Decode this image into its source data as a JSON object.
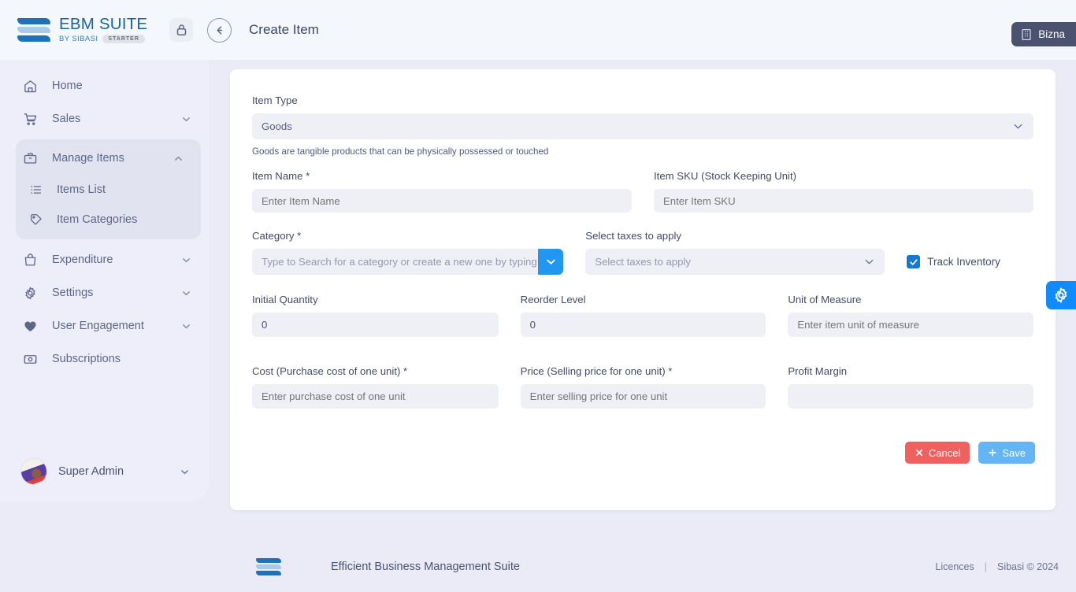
{
  "header": {
    "logo": {
      "title": "EBM SUITE",
      "subtitle": "BY SIBASI",
      "plan_badge": "STARTER"
    },
    "lock_icon": "lock-icon",
    "back_icon": "arrow-left-icon",
    "page_title": "Create Item",
    "org_badge": {
      "label": "Bizna",
      "icon": "building-icon"
    }
  },
  "sidebar": {
    "items": [
      {
        "label": "Home",
        "icon": "home-icon",
        "expandable": false
      },
      {
        "label": "Sales",
        "icon": "cart-icon",
        "expandable": true,
        "chevron": "chevron-down"
      },
      {
        "label": "Manage Items",
        "icon": "briefcase-icon",
        "expandable": true,
        "chevron": "chevron-up",
        "active": true
      },
      {
        "label": "Expenditure",
        "icon": "bag-icon",
        "expandable": true,
        "chevron": "chevron-down"
      },
      {
        "label": "Settings",
        "icon": "gear-icon",
        "expandable": true,
        "chevron": "chevron-down"
      },
      {
        "label": "User Engagement",
        "icon": "heart-icon",
        "expandable": true,
        "chevron": "chevron-down"
      },
      {
        "label": "Subscriptions",
        "icon": "subscription-icon",
        "expandable": false
      }
    ],
    "subitems": [
      {
        "label": "Items List",
        "icon": "list-icon"
      },
      {
        "label": "Item Categories",
        "icon": "tag-icon"
      }
    ],
    "user": {
      "name": "Super Admin",
      "chevron": "chevron-down"
    }
  },
  "form": {
    "item_type": {
      "label": "Item Type",
      "value": "Goods",
      "hint": "Goods are tangible products that can be physically possessed or touched"
    },
    "item_name": {
      "label": "Item Name *",
      "value": "",
      "placeholder": "Enter Item Name"
    },
    "item_sku": {
      "label": "Item SKU (Stock Keeping Unit)",
      "value": "",
      "placeholder": "Enter Item SKU"
    },
    "category": {
      "label": "Category *",
      "value": "",
      "placeholder": "Type to Search for a category or create a new one by typing in this"
    },
    "taxes": {
      "label": "Select taxes to apply",
      "value": "",
      "placeholder": "Select taxes to apply"
    },
    "track_inventory": {
      "label": "Track Inventory",
      "checked": true
    },
    "initial_quantity": {
      "label": "Initial Quantity",
      "value": "0",
      "placeholder": "0"
    },
    "reorder_level": {
      "label": "Reorder Level",
      "value": "0",
      "placeholder": "0"
    },
    "unit_of_measure": {
      "label": "Unit of Measure",
      "value": "",
      "placeholder": "Enter item unit of measure"
    },
    "cost": {
      "label": "Cost (Purchase cost of one unit) *",
      "value": "",
      "placeholder": "Enter purchase cost of one unit"
    },
    "price": {
      "label": "Price (Selling price for one unit) *",
      "value": "",
      "placeholder": "Enter selling price for one unit"
    },
    "profit_margin": {
      "label": "Profit Margin",
      "value": "",
      "placeholder": ""
    },
    "cancel_label": "Cancel",
    "save_label": "Save"
  },
  "float_tab": {
    "icon": "gear-icon"
  },
  "footer": {
    "tagline": "Efficient Business Management Suite",
    "licences": "Licences",
    "divider": "|",
    "copyright": "Sibasi © 2024"
  },
  "colors": {
    "accent_blue": "#2196f3",
    "brand_blue": "#1763a6",
    "cancel_red": "#f0605f",
    "save_blue": "#64b5f6",
    "checkbox_blue": "#1579d4",
    "page_bg": "#eaebf7"
  }
}
